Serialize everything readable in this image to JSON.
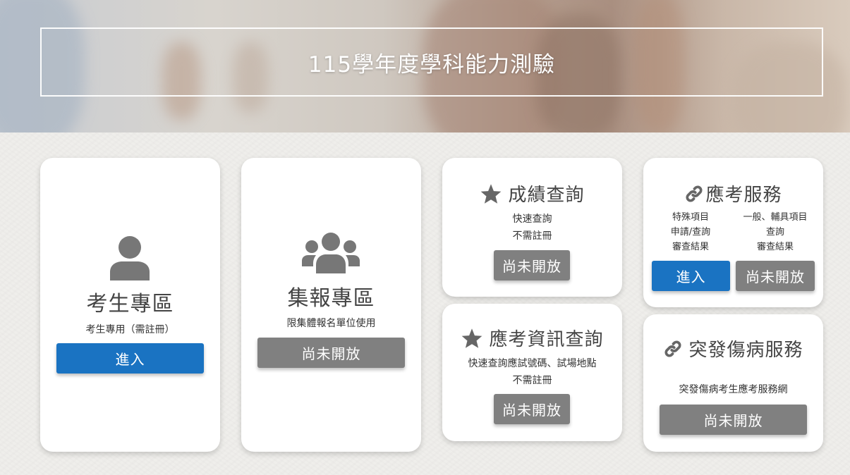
{
  "hero": {
    "title": "115學年度學科能力測驗"
  },
  "cards": {
    "student": {
      "icon": "user-icon",
      "title": "考生專區",
      "subtitle": "考生專用（需註冊）",
      "button": "進入"
    },
    "group": {
      "icon": "group-icon",
      "title": "集報專區",
      "subtitle": "限集體報名單位使用",
      "button": "尚未開放"
    },
    "score": {
      "icon": "star-icon",
      "title": "成績查詢",
      "line1": "快速查詢",
      "line2": "不需註冊",
      "button": "尚未開放"
    },
    "exam_info": {
      "icon": "star-icon",
      "title": "應考資訊查詢",
      "line1": "快速查詢應試號碼、試場地點",
      "line2": "不需註冊",
      "button": "尚未開放"
    },
    "service": {
      "icon": "link-icon",
      "title": "應考服務",
      "col1": [
        "特殊項目",
        "申請/查詢",
        "審查結果"
      ],
      "col2": [
        "一般、輔具項目",
        "查詢",
        "審查結果"
      ],
      "button1": "進入",
      "button2": "尚未開放"
    },
    "emergency": {
      "icon": "link-icon",
      "title": "突發傷病服務",
      "subtitle": "突發傷病考生應考服務網",
      "button": "尚未開放"
    }
  }
}
